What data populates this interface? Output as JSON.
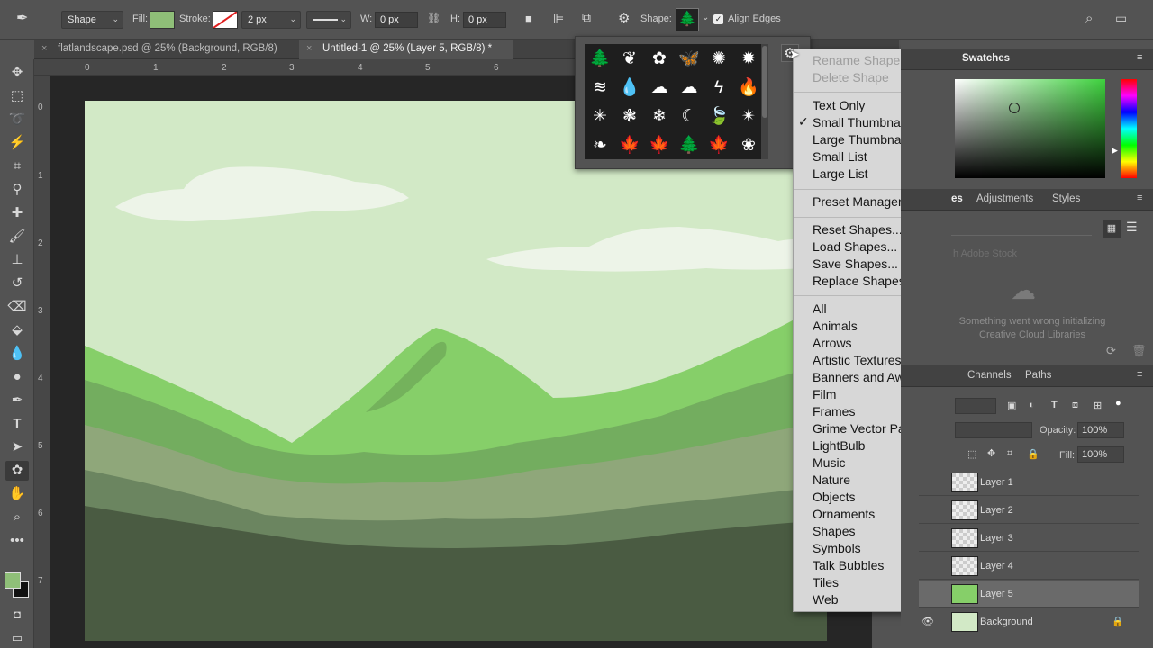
{
  "options_bar": {
    "mode": "Shape",
    "fill_label": "Fill:",
    "stroke_label": "Stroke:",
    "stroke_size": "2 px",
    "w_label": "W:",
    "w_value": "0 px",
    "h_label": "H:",
    "h_value": "0 px",
    "shape_label": "Shape:",
    "align_edges": "Align Edges",
    "fill_color": "#8fbf78"
  },
  "tabs": [
    {
      "label": "flatlandscape.psd @ 25% (Background, RGB/8)"
    },
    {
      "label": "Untitled-1 @ 25% (Layer 5, RGB/8) *"
    }
  ],
  "ruler_h": [
    "0",
    "1",
    "2",
    "3",
    "4",
    "5",
    "6"
  ],
  "ruler_v": [
    "0",
    "1",
    "2",
    "3",
    "4",
    "5",
    "6",
    "7"
  ],
  "shapes": [
    "🌲",
    "❦",
    "✿",
    "🦋",
    "✺",
    "✹",
    "≋",
    "💧",
    "☁",
    "☁",
    "ϟ",
    "🔥",
    "✳",
    "❃",
    "❄",
    "☾",
    "🍃",
    "✴",
    "❧",
    "🍁",
    "🍁",
    "🌲",
    "🍁",
    "❀"
  ],
  "menu": {
    "rename": "Rename Shape...",
    "delete": "Delete Shape",
    "view": [
      "Text Only",
      "Small Thumbnail",
      "Large Thumbnail",
      "Small List",
      "Large List"
    ],
    "checked_mark": "✓",
    "preset": "Preset Manager...",
    "file_ops": [
      "Reset Shapes...",
      "Load Shapes...",
      "Save Shapes...",
      "Replace Shapes..."
    ],
    "sets": [
      "All",
      "Animals",
      "Arrows",
      "Artistic Textures",
      "Banners and Awards",
      "Film",
      "Frames",
      "Grime Vector Pack",
      "LightBulb",
      "Music",
      "Nature",
      "Objects",
      "Ornaments",
      "Shapes",
      "Symbols",
      "Talk Bubbles",
      "Tiles",
      "Web"
    ]
  },
  "panels": {
    "swatches": "Swatches",
    "lib_tab": "es",
    "adjustments": "Adjustments",
    "styles": "Styles",
    "adobe_stock": "h Adobe Stock",
    "cc_error": "Something went wrong initializing Creative Cloud Libraries",
    "channels": "Channels",
    "paths": "Paths",
    "opacity_label": "Opacity:",
    "opacity_value": "100%",
    "fill_label": "Fill:",
    "fill_value": "100%",
    "layers": [
      "Layer 1",
      "Layer 2",
      "Layer 3",
      "Layer 4",
      "Layer 5",
      "Background"
    ]
  }
}
